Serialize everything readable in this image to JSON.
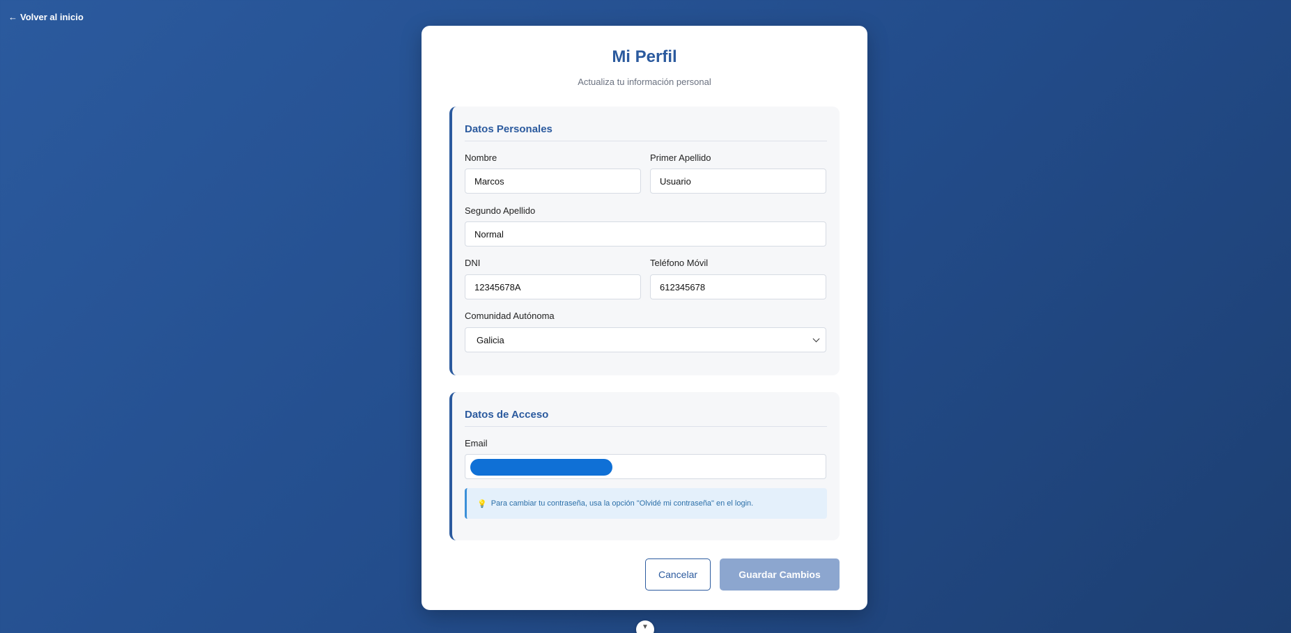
{
  "nav": {
    "back_arrow": "←",
    "back_label": "Volver al inicio"
  },
  "header": {
    "title": "Mi Perfil",
    "subtitle": "Actualiza tu información personal"
  },
  "personal": {
    "section_title": "Datos Personales",
    "nombre": {
      "label": "Nombre",
      "value": "Marcos"
    },
    "primer_apellido": {
      "label": "Primer Apellido",
      "value": "Usuario"
    },
    "segundo_apellido": {
      "label": "Segundo Apellido",
      "value": "Normal"
    },
    "dni": {
      "label": "DNI",
      "value": "12345678A"
    },
    "telefono": {
      "label": "Teléfono Móvil",
      "value": "612345678"
    },
    "comunidad": {
      "label": "Comunidad Autónoma",
      "selected": "Galicia"
    }
  },
  "access": {
    "section_title": "Datos de Acceso",
    "email": {
      "label": "Email"
    },
    "info_icon": "lightbulb-icon",
    "info_text": "Para cambiar tu contraseña, usa la opción \"Olvidé mi contraseña\" en el login."
  },
  "actions": {
    "cancel_label": "Cancelar",
    "save_label": "Guardar Cambios"
  },
  "colors": {
    "primary": "#2b5a9e",
    "save_disabled": "#8ca6cf",
    "info_bg": "#e4f0fb",
    "redaction": "#0f70d6"
  }
}
